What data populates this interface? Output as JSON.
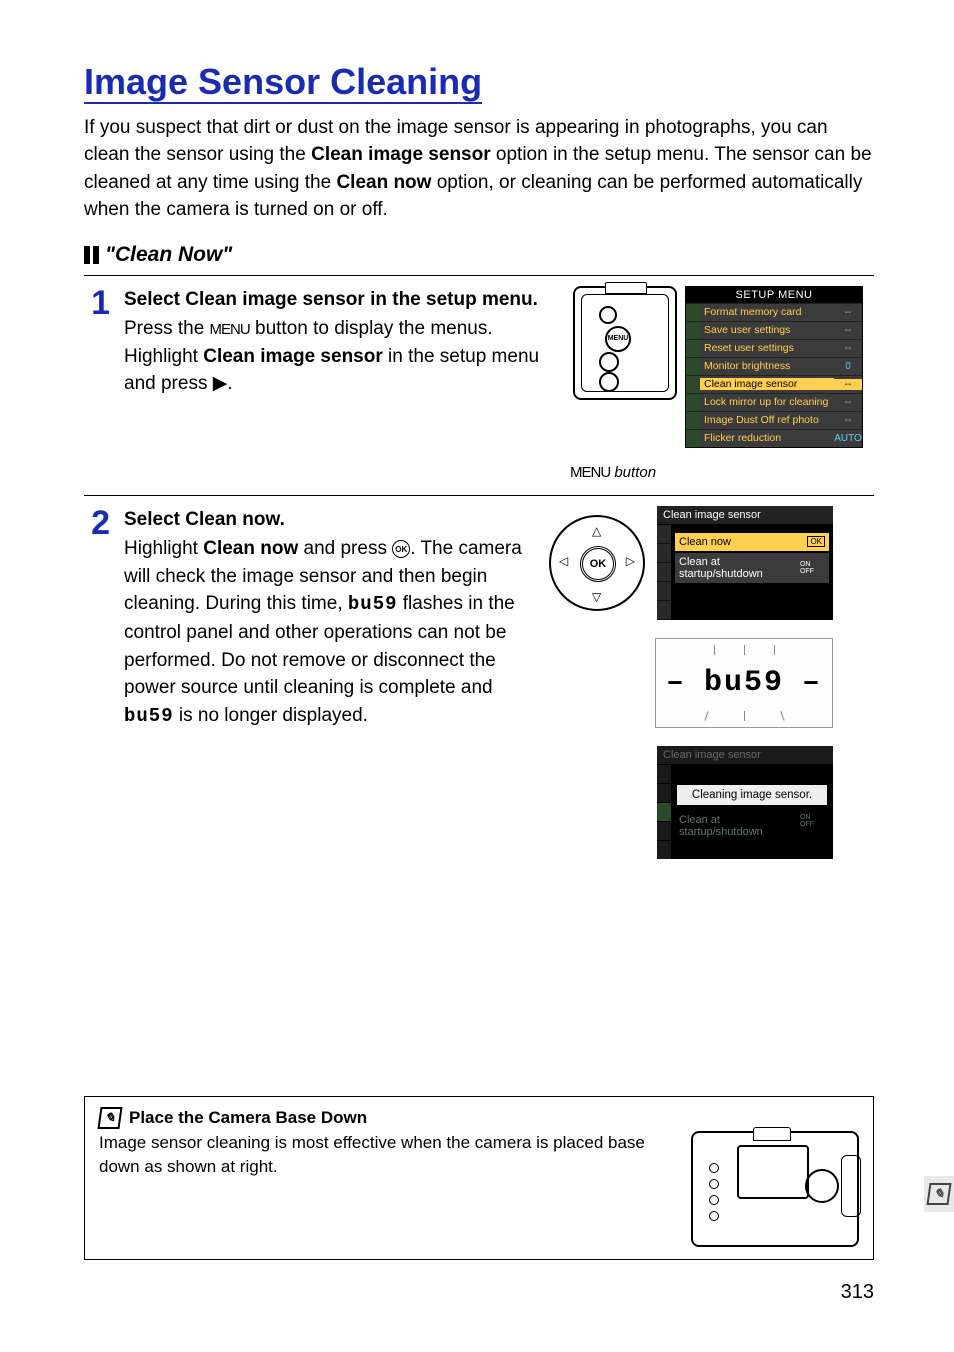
{
  "title": "Image Sensor Cleaning",
  "intro_parts": {
    "a": "If you suspect that dirt or dust on the image sensor is appearing in photographs, you can clean the sensor using the ",
    "b": "Clean image sensor",
    "c": " option in the setup menu.  The sensor can be cleaned at any time using the ",
    "d": "Clean now",
    "e": " option, or cleaning can be performed automatically when the camera is turned on or off."
  },
  "subhead": "\"Clean Now\"",
  "steps": [
    {
      "num": "1",
      "title_a": "Select ",
      "title_b": "Clean image sensor",
      "title_c": " in the setup menu.",
      "body_a": "Press the ",
      "body_b": "MENU",
      "body_c": " button to display the menus.  Highlight ",
      "body_d": "Clean image sensor",
      "body_e": " in the setup menu and press ",
      "body_f": "▶",
      "body_g": "."
    },
    {
      "num": "2",
      "title_a": "Select ",
      "title_b": "Clean now",
      "title_c": ".",
      "body_a": "Highlight ",
      "body_b": "Clean now",
      "body_c": " and press ",
      "body_ok": "OK",
      "body_d": ".  The camera will check the image sensor and then begin cleaning.  During this time, ",
      "body_busy1": "bu59",
      "body_e": " flashes in the control panel and other operations can not be performed.  Do not remove or disconnect the power source until cleaning is complete and ",
      "body_busy2": "bu59",
      "body_f": " is no longer displayed."
    }
  ],
  "menu": {
    "title": "SETUP MENU",
    "caption_glyph": "MENU",
    "caption_text": " button",
    "rows": [
      {
        "label": "Format memory card",
        "val": "--"
      },
      {
        "label": "Save user settings",
        "val": "--"
      },
      {
        "label": "Reset user settings",
        "val": "--"
      },
      {
        "label": "Monitor brightness",
        "val": "0"
      },
      {
        "label": "Clean image sensor",
        "val": "--",
        "hl": true
      },
      {
        "label": "Lock mirror up for cleaning",
        "val": "--"
      },
      {
        "label": "Image Dust Off ref photo",
        "val": "--"
      },
      {
        "label": "Flicker reduction",
        "val": "AUTO"
      }
    ]
  },
  "submenu1": {
    "hdr": "Clean image sensor",
    "opt1": "Clean now",
    "opt1_badge": "OK",
    "opt2": "Clean at startup/shutdown",
    "opt2_badge": "ON OFF"
  },
  "busy_lcd": "bu59",
  "submenu2": {
    "hdr": "Clean image sensor",
    "msg": "Cleaning image sensor.",
    "opt": "Clean at startup/shutdown",
    "opt_badge": "ON OFF"
  },
  "note": {
    "head": "Place the Camera Base Down",
    "body": "Image sensor cleaning is most effective when the camera is placed base down as shown at right."
  },
  "ok_label": "OK",
  "cam_menu_btn": "MENU",
  "page_number": "313"
}
